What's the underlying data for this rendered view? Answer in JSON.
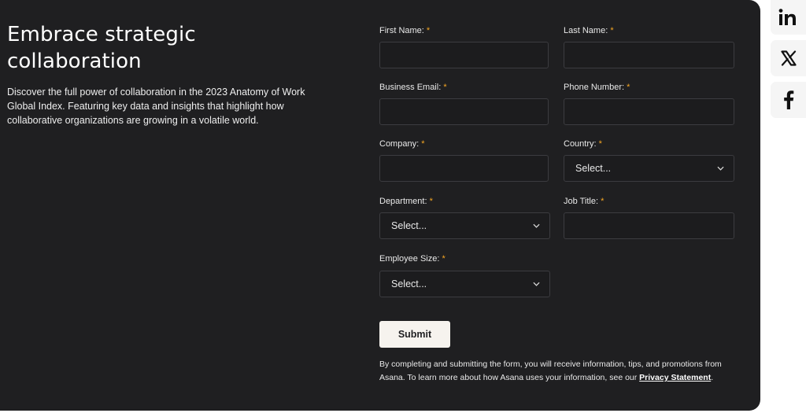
{
  "hero": {
    "title": "Embrace strategic collaboration",
    "description": "Discover the full power of collaboration in the 2023 Anatomy of Work Global Index. Featuring key data and insights that highlight how collaborative organizations are growing in a volatile world."
  },
  "form": {
    "required_marker": "*",
    "first_name": {
      "label": "First Name:",
      "value": ""
    },
    "last_name": {
      "label": "Last Name:",
      "value": ""
    },
    "business_email": {
      "label": "Business Email:",
      "value": ""
    },
    "phone_number": {
      "label": "Phone Number:",
      "value": ""
    },
    "company": {
      "label": "Company:",
      "value": ""
    },
    "country": {
      "label": "Country:",
      "selected": "Select..."
    },
    "department": {
      "label": "Department:",
      "selected": "Select..."
    },
    "job_title": {
      "label": "Job Title:",
      "value": ""
    },
    "employee_size": {
      "label": "Employee Size:",
      "selected": "Select..."
    },
    "submit_label": "Submit",
    "disclaimer_text": "By completing and submitting the form, you will receive information, tips, and promotions from Asana. To learn more about how Asana uses your information, see our ",
    "privacy_link": "Privacy Statement",
    "disclaimer_end": "."
  },
  "social": [
    {
      "icon": "linkedin-icon"
    },
    {
      "icon": "x-twitter-icon"
    },
    {
      "icon": "facebook-icon"
    }
  ],
  "colors": {
    "panel_background": "#1f1f21",
    "required_asterisk": "#f5a623",
    "button_background": "#f6f3ee",
    "field_border": "#3c3c40"
  }
}
